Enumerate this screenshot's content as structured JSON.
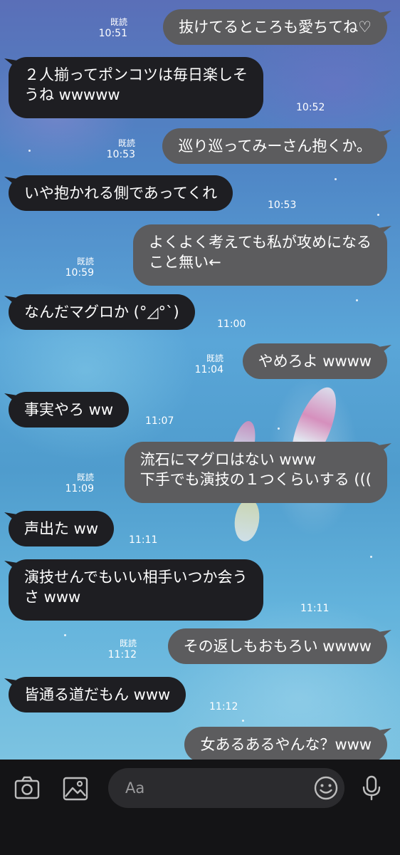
{
  "chat": {
    "messages": [
      {
        "side": "out",
        "lines": [
          "抜けてるところも愛ちてね♡"
        ],
        "read": "既読",
        "time": "10:51"
      },
      {
        "side": "in",
        "lines": [
          "２人揃ってポンコツは毎日楽しそ",
          "うね wwwww"
        ],
        "time": "10:52"
      },
      {
        "side": "out",
        "lines": [
          "巡り巡ってみーさん抱くか。"
        ],
        "read": "既読",
        "time": "10:53"
      },
      {
        "side": "in",
        "lines": [
          "いや抱かれる側であってくれ"
        ],
        "time": "10:53"
      },
      {
        "side": "out",
        "lines": [
          "よくよく考えても私が攻めになる",
          "こと無い←"
        ],
        "read": "既読",
        "time": "10:59"
      },
      {
        "side": "in",
        "lines": [
          "なんだマグロか (°◿°`)"
        ],
        "time": "11:00"
      },
      {
        "side": "out",
        "lines": [
          "やめろよ wwww"
        ],
        "read": "既読",
        "time": "11:04"
      },
      {
        "side": "in",
        "lines": [
          "事実やろ ww"
        ],
        "time": "11:07"
      },
      {
        "side": "out",
        "lines": [
          "流石にマグロはない www",
          "下手でも演技の１つくらいする ((("
        ],
        "read": "既読",
        "time": "11:09"
      },
      {
        "side": "in",
        "lines": [
          "声出た ww"
        ],
        "time": "11:11"
      },
      {
        "side": "in",
        "lines": [
          "演技せんでもいい相手いつか会う",
          "さ www"
        ],
        "time": "11:11"
      },
      {
        "side": "out",
        "lines": [
          "その返しもおもろい wwww"
        ],
        "read": "既読",
        "time": "11:12"
      },
      {
        "side": "in",
        "lines": [
          "皆通る道だもん www"
        ],
        "time": "11:12"
      },
      {
        "side": "out",
        "lines": [
          "女あるあるやんな？www"
        ],
        "read": "",
        "time": ""
      }
    ]
  },
  "input_bar": {
    "placeholder": "Aa",
    "icons": [
      "camera-icon",
      "image-icon",
      "emoji-icon",
      "microphone-icon"
    ]
  },
  "colors": {
    "incoming_bubble": "#1e1e22",
    "outgoing_bubble": "#5c5c5e",
    "input_bar_bg": "#141416",
    "text_field_bg": "#2b2b2e"
  }
}
